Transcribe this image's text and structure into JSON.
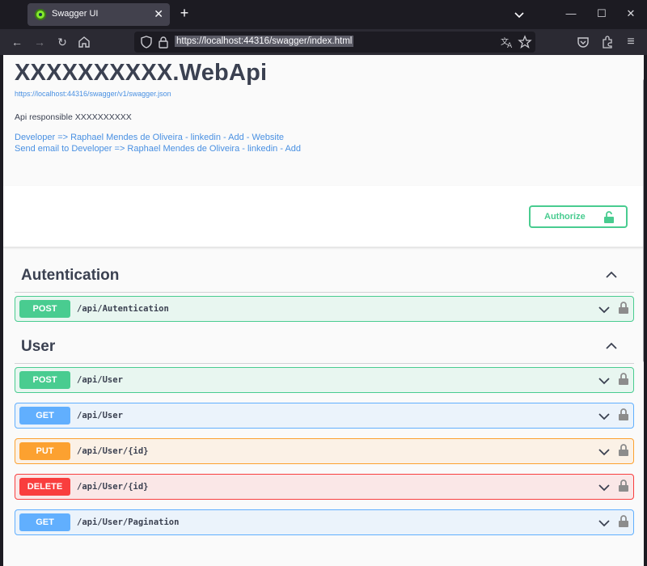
{
  "browser": {
    "tab_title": "Swagger UI",
    "url": "https://localhost:44316/swagger/index.html"
  },
  "info": {
    "title": "XXXXXXXXXX.WebApi",
    "spec_url": "https://localhost:44316/swagger/v1/swagger.json",
    "description": "Api responsible XXXXXXXXXX",
    "contact_line_1": "Developer => Raphael Mendes de Oliveira - linkedin - Add - Website",
    "contact_line_2": "Send email to Developer => Raphael Mendes de Oliveira - linkedin - Add"
  },
  "authorize_label": "Authorize",
  "tags": [
    {
      "name": "Autentication",
      "operations": [
        {
          "method": "POST",
          "path": "/api/Autentication"
        }
      ]
    },
    {
      "name": "User",
      "operations": [
        {
          "method": "POST",
          "path": "/api/User"
        },
        {
          "method": "GET",
          "path": "/api/User"
        },
        {
          "method": "PUT",
          "path": "/api/User/{id}"
        },
        {
          "method": "DELETE",
          "path": "/api/User/{id}"
        },
        {
          "method": "GET",
          "path": "/api/User/Pagination"
        }
      ]
    }
  ],
  "colors": {
    "post": "#49cc90",
    "get": "#61affe",
    "put": "#fca130",
    "delete": "#f93e3e",
    "link": "#4990e2"
  }
}
